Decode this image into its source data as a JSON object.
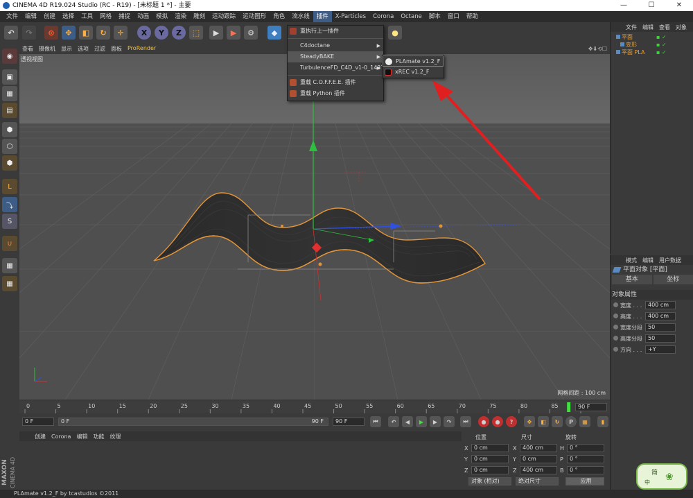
{
  "window": {
    "title": "CINEMA 4D R19.024 Studio (RC - R19) - [未标题 1 *] - 主要",
    "min": "—",
    "max": "☐",
    "close": "✕"
  },
  "menubar": [
    "文件",
    "编辑",
    "创建",
    "选择",
    "工具",
    "网格",
    "捕捉",
    "动画",
    "模拟",
    "渲染",
    "雕刻",
    "运动跟踪",
    "运动图形",
    "角色",
    "流水线",
    "插件",
    "X-Particles",
    "Corona",
    "Octane",
    "脚本",
    "窗口",
    "帮助"
  ],
  "viewport": {
    "menu": [
      "查看",
      "摄像机",
      "显示",
      "选项",
      "过滤",
      "面板",
      "ProRender"
    ],
    "label": "透视视图",
    "grid_info": "网格间距 : 100 cm",
    "nav_icons": "✥⬇⟲☐"
  },
  "plugin_menu": {
    "items": [
      {
        "label": "重执行上一插件",
        "has_sub": false
      },
      {
        "label": "C4doctane",
        "has_sub": true
      },
      {
        "label": "SteadyBAKE",
        "has_sub": true
      },
      {
        "label": "TurbulenceFD_C4D_v1-0_1437",
        "has_sub": true
      },
      {
        "label": "重载 C.O.F.F.E.E. 插件",
        "has_sub": false
      },
      {
        "label": "重载 Python 插件",
        "has_sub": false
      }
    ],
    "submenu": [
      "PLAmate v1.2_F",
      "xREC v1.2_F"
    ]
  },
  "timeline": {
    "ticks": [
      "0",
      "5",
      "10",
      "15",
      "20",
      "25",
      "30",
      "35",
      "40",
      "45",
      "50",
      "55",
      "60",
      "65",
      "70",
      "75",
      "80",
      "85",
      "90"
    ],
    "end_frame": "90 F",
    "playhead_value": 88
  },
  "transport": {
    "start": "0 F",
    "range_start": "0 F",
    "range_end": "90 F",
    "end": "90 F"
  },
  "material_panel": {
    "tabs": [
      "创建",
      "Corona",
      "编辑",
      "功能",
      "纹理"
    ]
  },
  "coord_panel": {
    "headers": [
      "位置",
      "尺寸",
      "旋转"
    ],
    "rows": [
      {
        "axis": "X",
        "pos": "0 cm",
        "size_axis": "X",
        "size": "400 cm",
        "rot_axis": "H",
        "rot": "0 °"
      },
      {
        "axis": "Y",
        "pos": "0 cm",
        "size_axis": "Y",
        "size": "0 cm",
        "rot_axis": "P",
        "rot": "0 °"
      },
      {
        "axis": "Z",
        "pos": "0 cm",
        "size_axis": "Z",
        "size": "400 cm",
        "rot_axis": "B",
        "rot": "0 °"
      }
    ],
    "mode1": "对象 (相对)",
    "mode2": "绝对尺寸",
    "apply": "应用"
  },
  "object_manager": {
    "tabs": [
      "文件",
      "编辑",
      "查看",
      "对象"
    ],
    "objects": [
      {
        "name": "平面",
        "color": "#f0a030"
      },
      {
        "name": "变形",
        "color": "#d8a040"
      },
      {
        "name": "平面 PLA",
        "color": "#f0a030"
      }
    ]
  },
  "attribute_manager": {
    "tabs": [
      "模式",
      "编辑",
      "用户数据"
    ],
    "title": "平面对象 [平面]",
    "subtabs": [
      "基本",
      "坐标"
    ],
    "section": "对象属性",
    "fields": [
      {
        "label": "宽度 . . .",
        "value": "400 cm"
      },
      {
        "label": "高度 . . .",
        "value": "400 cm"
      },
      {
        "label": "宽度分段",
        "value": "50"
      },
      {
        "label": "高度分段",
        "value": "50"
      },
      {
        "label": "方向 . . .",
        "value": "+Y"
      }
    ]
  },
  "statusbar": "PLAmate v1.2_F by tcastudios ©2011",
  "widget": {
    "text": "简",
    "sub": "中"
  },
  "brand": {
    "line1": "MAXON",
    "line2": "CINEMA 4D"
  }
}
